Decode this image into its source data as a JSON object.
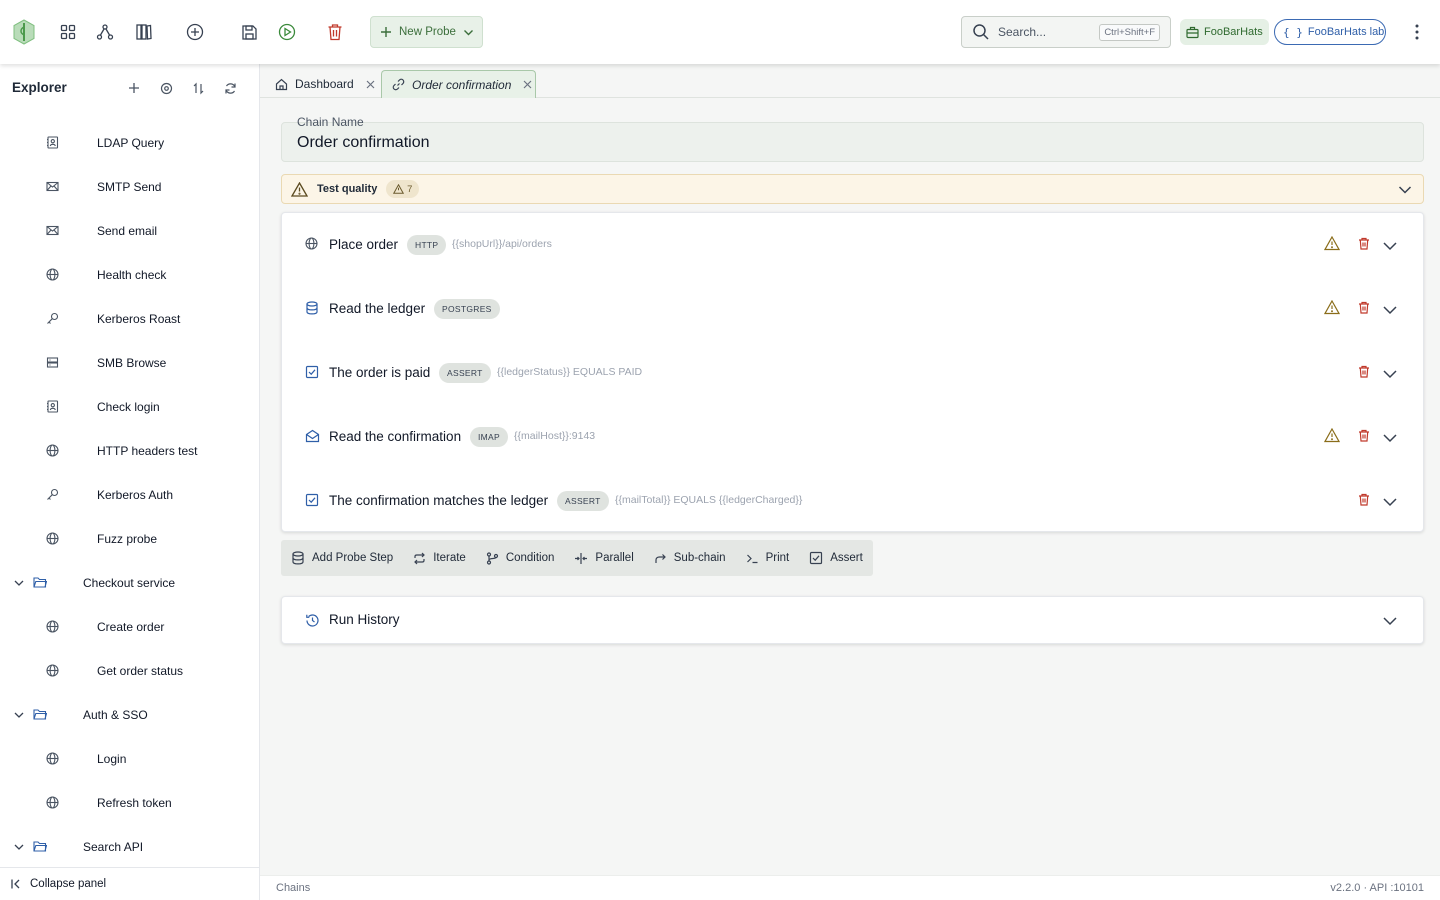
{
  "topbar": {
    "new_probe_label": "New Probe",
    "search_placeholder": "Search...",
    "search_shortcut": "Ctrl+Shift+F",
    "workspace_label": "FooBarHats",
    "environment_label": "FooBarHats lab"
  },
  "sidebar": {
    "title": "Explorer",
    "items": [
      {
        "label": "LDAP Query",
        "icon": "contact-icon"
      },
      {
        "label": "SMTP Send",
        "icon": "mail-icon"
      },
      {
        "label": "Send email",
        "icon": "mail-icon"
      },
      {
        "label": "Health check",
        "icon": "globe-icon"
      },
      {
        "label": "Kerberos Roast",
        "icon": "key-icon"
      },
      {
        "label": "SMB Browse",
        "icon": "server-icon"
      },
      {
        "label": "Check login",
        "icon": "contact-icon"
      },
      {
        "label": "HTTP headers test",
        "icon": "globe-icon"
      },
      {
        "label": "Kerberos Auth",
        "icon": "key-icon"
      },
      {
        "label": "Fuzz probe",
        "icon": "globe-icon"
      },
      {
        "label": "Checkout service",
        "icon": "folder-icon",
        "folder": true
      },
      {
        "label": "Create order",
        "icon": "globe-icon"
      },
      {
        "label": "Get order status",
        "icon": "globe-icon"
      },
      {
        "label": "Auth & SSO",
        "icon": "folder-icon",
        "folder": true
      },
      {
        "label": "Login",
        "icon": "globe-icon"
      },
      {
        "label": "Refresh token",
        "icon": "globe-icon"
      },
      {
        "label": "Search API",
        "icon": "folder-icon",
        "folder": true
      }
    ],
    "collapse_label": "Collapse panel"
  },
  "tabs": [
    {
      "label": "Dashboard",
      "icon": "home-icon"
    },
    {
      "label": "Order confirmation",
      "icon": "link-icon",
      "active": true
    }
  ],
  "chain": {
    "name_caption": "Chain Name",
    "name_value": "Order confirmation"
  },
  "quality": {
    "label": "Test quality",
    "count": "7"
  },
  "steps": [
    {
      "name": "Place order",
      "badge": "HTTP",
      "detail": "{{shopUrl}}/api/orders",
      "icon": "globe-icon",
      "warn": true
    },
    {
      "name": "Read the ledger",
      "badge": "POSTGRES",
      "detail": "",
      "icon": "database-icon",
      "warn": true
    },
    {
      "name": "The order is paid",
      "badge": "ASSERT",
      "detail": "{{ledgerStatus}} EQUALS PAID",
      "icon": "checkbox-icon",
      "warn": false
    },
    {
      "name": "Read the confirmation",
      "badge": "IMAP",
      "detail": "{{mailHost}}:9143",
      "icon": "mail-open-icon",
      "warn": true
    },
    {
      "name": "The confirmation matches the ledger",
      "badge": "ASSERT",
      "detail": "{{mailTotal}} EQUALS {{ledgerCharged}}",
      "icon": "checkbox-icon",
      "warn": false
    }
  ],
  "add_actions": [
    {
      "label": "Add Probe Step",
      "icon": "database-icon"
    },
    {
      "label": "Iterate",
      "icon": "repeat-icon"
    },
    {
      "label": "Condition",
      "icon": "branch-icon"
    },
    {
      "label": "Parallel",
      "icon": "parallel-icon"
    },
    {
      "label": "Sub-chain",
      "icon": "forward-icon"
    },
    {
      "label": "Print",
      "icon": "terminal-icon"
    },
    {
      "label": "Assert",
      "icon": "checkbox-icon"
    }
  ],
  "history": {
    "label": "Run History"
  },
  "footer": {
    "left": "Chains",
    "right": "v2.2.0  · API :10101"
  },
  "colors": {
    "accent": "#3b6e3b",
    "step_icon": "#2f5fa8",
    "delete": "#c0392b",
    "warning": "#8a6d1a"
  }
}
